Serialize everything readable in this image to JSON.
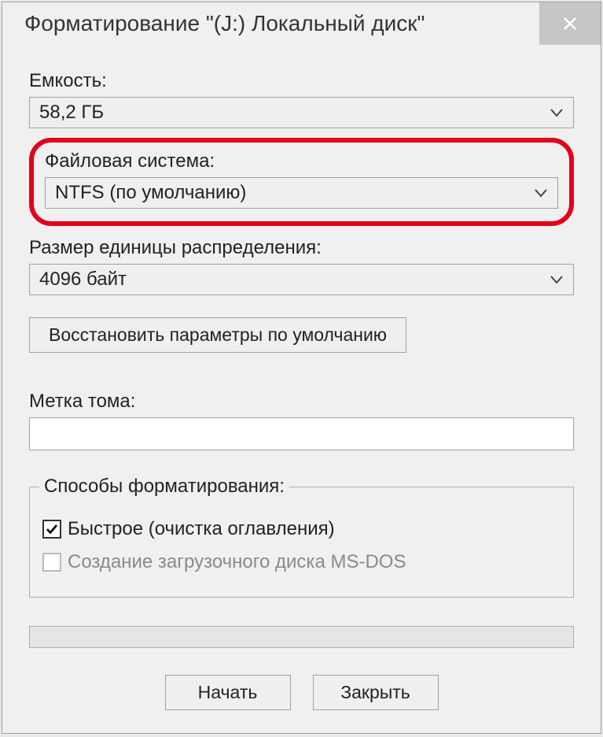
{
  "window": {
    "title": "Форматирование \"(J:) Локальный диск\""
  },
  "capacity": {
    "label": "Емкость:",
    "value": "58,2 ГБ"
  },
  "filesystem": {
    "label": "Файловая система:",
    "value": "NTFS (по умолчанию)"
  },
  "allocation": {
    "label": "Размер единицы распределения:",
    "value": "4096 байт"
  },
  "restore_button": "Восстановить параметры по умолчанию",
  "volume_label": {
    "label": "Метка тома:",
    "value": ""
  },
  "format_options": {
    "legend": "Способы форматирования:",
    "quick": "Быстрое (очистка оглавления)",
    "msdos": "Создание загрузочного диска MS-DOS"
  },
  "buttons": {
    "start": "Начать",
    "close": "Закрыть"
  }
}
